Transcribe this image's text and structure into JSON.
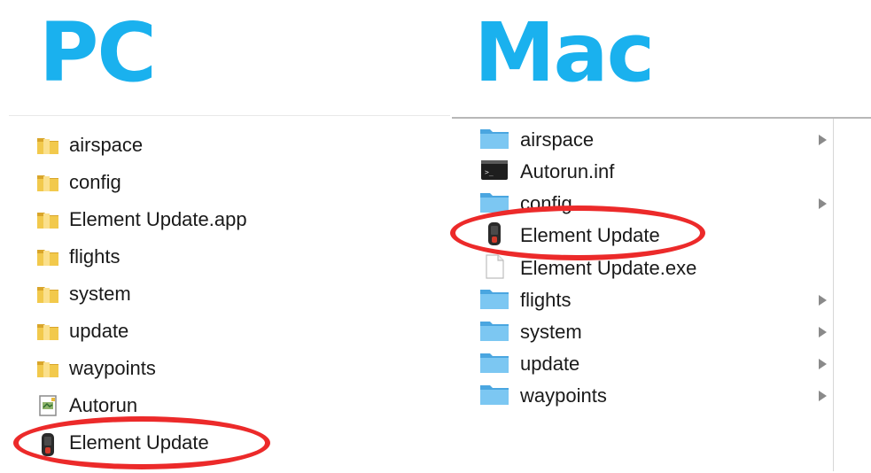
{
  "pc": {
    "title": "PC",
    "items": [
      {
        "label": "airspace",
        "icon": "folder-icon"
      },
      {
        "label": "config",
        "icon": "folder-icon"
      },
      {
        "label": "Element Update.app",
        "icon": "folder-icon"
      },
      {
        "label": "flights",
        "icon": "folder-icon"
      },
      {
        "label": "system",
        "icon": "folder-icon"
      },
      {
        "label": "update",
        "icon": "folder-icon"
      },
      {
        "label": "waypoints",
        "icon": "folder-icon"
      },
      {
        "label": "Autorun",
        "icon": "autorun-file-icon"
      },
      {
        "label": "Element Update",
        "icon": "device-app-icon",
        "highlighted": true
      }
    ]
  },
  "mac": {
    "title": "Mac",
    "items": [
      {
        "label": "airspace",
        "icon": "folder-icon",
        "has_children": true
      },
      {
        "label": "Autorun.inf",
        "icon": "terminal-file-icon",
        "has_children": false
      },
      {
        "label": "config",
        "icon": "folder-icon",
        "has_children": true
      },
      {
        "label": "Element Update",
        "icon": "device-app-icon",
        "has_children": false,
        "highlighted": true
      },
      {
        "label": "Element Update.exe",
        "icon": "blank-file-icon",
        "has_children": false
      },
      {
        "label": "flights",
        "icon": "folder-icon",
        "has_children": true
      },
      {
        "label": "system",
        "icon": "folder-icon",
        "has_children": true
      },
      {
        "label": "update",
        "icon": "folder-icon",
        "has_children": true
      },
      {
        "label": "waypoints",
        "icon": "folder-icon",
        "has_children": true
      }
    ]
  },
  "colors": {
    "title": "#1ab1ee",
    "highlight": "#ec2a2a",
    "win_folder": "#e8b93a",
    "mac_folder": "#5eb7ea"
  }
}
